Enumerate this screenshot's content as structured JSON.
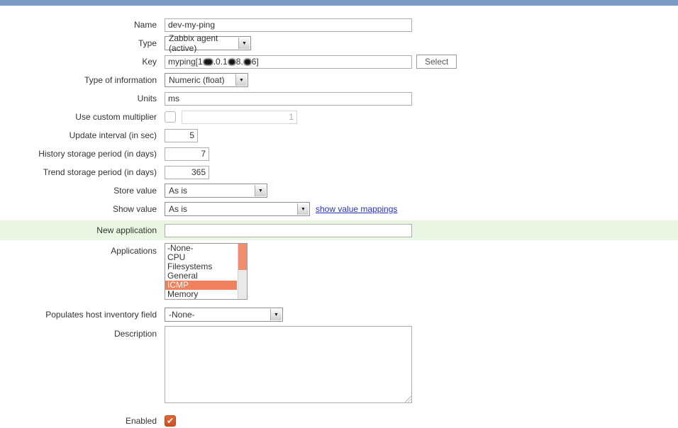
{
  "icons": {
    "dropdown_arrow": "▼",
    "checkmark": "✔"
  },
  "colors": {
    "topbar": "#7a9cc4",
    "new_application_row_bg": "#e9f6e1",
    "selected_list_item_bg": "#f0815c",
    "scrollbar_thumb": "#f08e6e",
    "enabled_checkbox": "#cc4f20",
    "link": "#2433c9"
  },
  "form": {
    "name": {
      "label": "Name",
      "value": "dev-my-ping"
    },
    "type": {
      "label": "Type",
      "value": "Zabbix agent (active)"
    },
    "key": {
      "label": "Key",
      "part1": "myping[1",
      "part2": ".0.1",
      "part3": "8.",
      "part4": "6]",
      "redacted": true,
      "select_button": "Select"
    },
    "type_of_information": {
      "label": "Type of information",
      "value": "Numeric (float)"
    },
    "units": {
      "label": "Units",
      "value": "ms"
    },
    "custom_multiplier": {
      "label": "Use custom multiplier",
      "checked": false,
      "value": "1"
    },
    "update_interval": {
      "label": "Update interval (in sec)",
      "value": "5"
    },
    "history_storage": {
      "label": "History storage period (in days)",
      "value": "7"
    },
    "trend_storage": {
      "label": "Trend storage period (in days)",
      "value": "365"
    },
    "store_value": {
      "label": "Store value",
      "value": "As is"
    },
    "show_value": {
      "label": "Show value",
      "value": "As is",
      "link": "show value mappings"
    },
    "new_application": {
      "label": "New application",
      "value": "",
      "placeholder": ""
    },
    "applications": {
      "label": "Applications",
      "items": [
        "-None-",
        "CPU",
        "Filesystems",
        "General",
        "ICMP",
        "Memory"
      ],
      "selected": "ICMP",
      "selected_index": 4
    },
    "inventory_field": {
      "label": "Populates host inventory field",
      "value": "-None-"
    },
    "description": {
      "label": "Description",
      "value": ""
    },
    "enabled": {
      "label": "Enabled",
      "checked": true
    }
  }
}
